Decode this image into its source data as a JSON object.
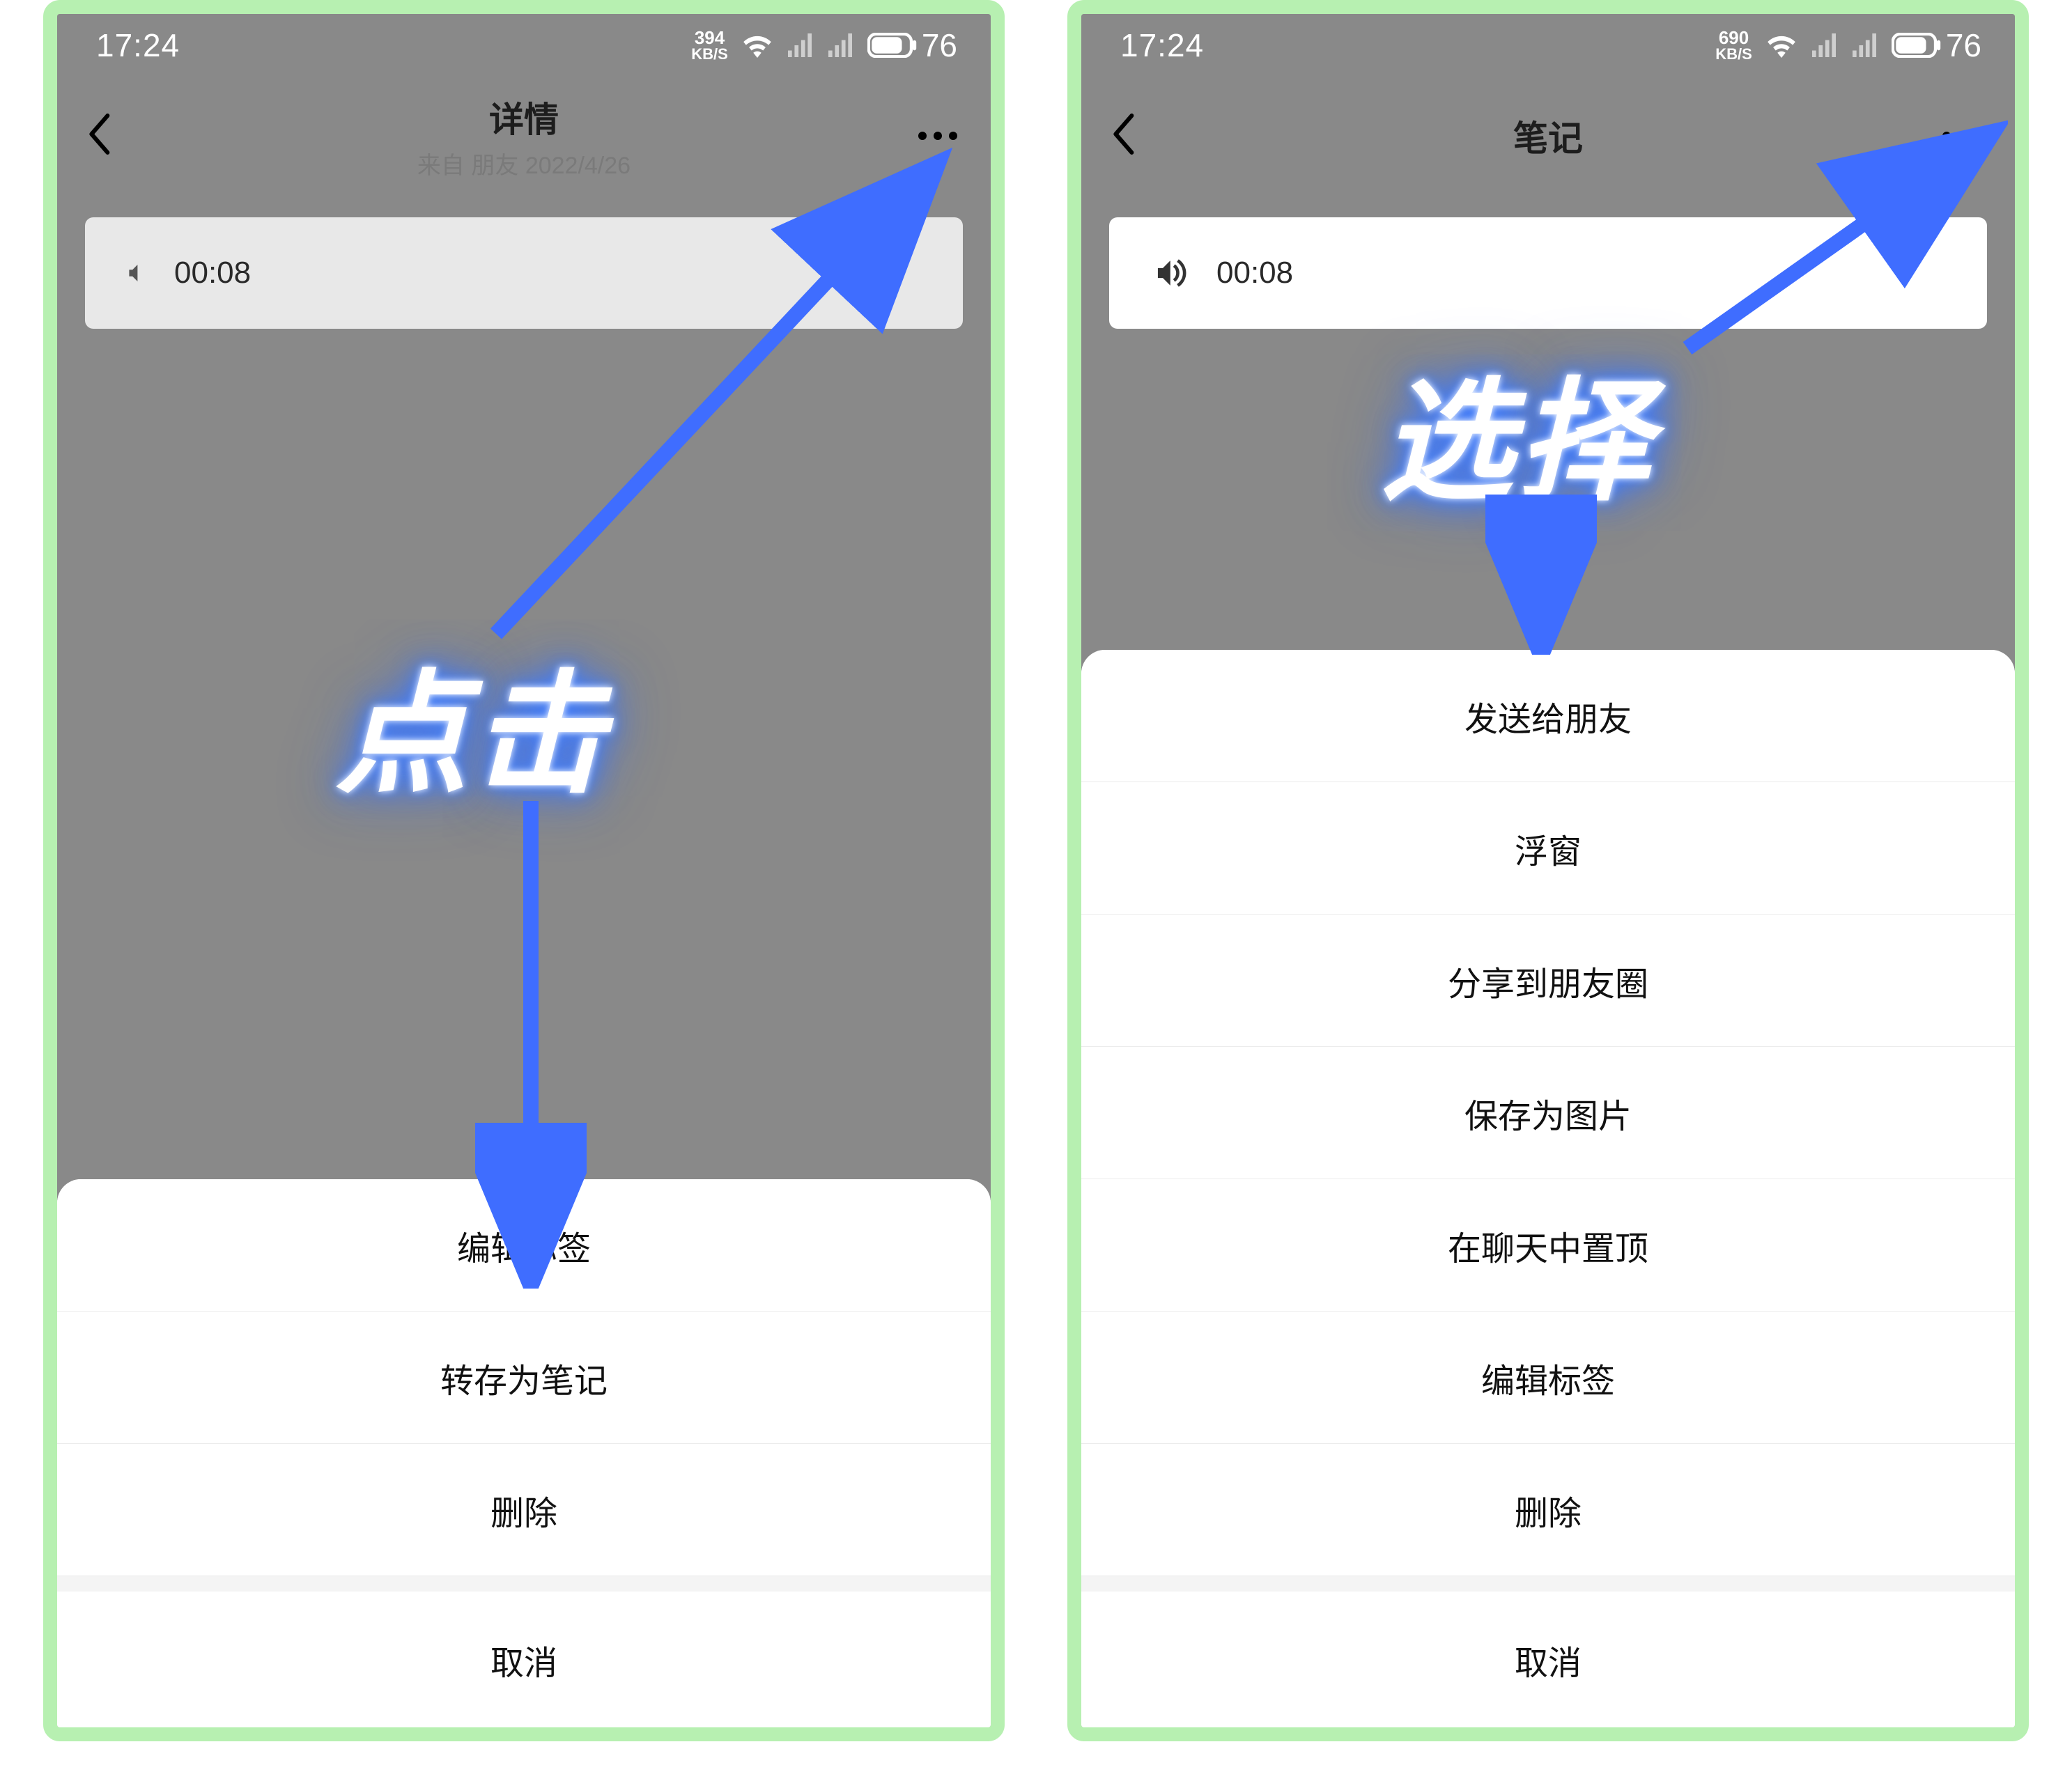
{
  "left": {
    "status": {
      "time": "17:24",
      "kbps_top": "394",
      "kbps_bot": "KB/S",
      "battery": "76"
    },
    "nav": {
      "title": "详情",
      "subtitle": "来自 朋友 2022/4/26"
    },
    "audio": {
      "duration": "00:08"
    },
    "sheet": {
      "items": [
        "编辑标签",
        "转存为笔记",
        "删除"
      ],
      "cancel": "取消"
    },
    "annotation": "点击"
  },
  "right": {
    "status": {
      "time": "17:24",
      "kbps_top": "690",
      "kbps_bot": "KB/S",
      "battery": "76"
    },
    "nav": {
      "title": "笔记"
    },
    "audio": {
      "duration": "00:08"
    },
    "sheet": {
      "items": [
        "发送给朋友",
        "浮窗",
        "分享到朋友圈",
        "保存为图片",
        "在聊天中置顶",
        "编辑标签",
        "删除"
      ],
      "cancel": "取消"
    },
    "annotation": "选择"
  }
}
